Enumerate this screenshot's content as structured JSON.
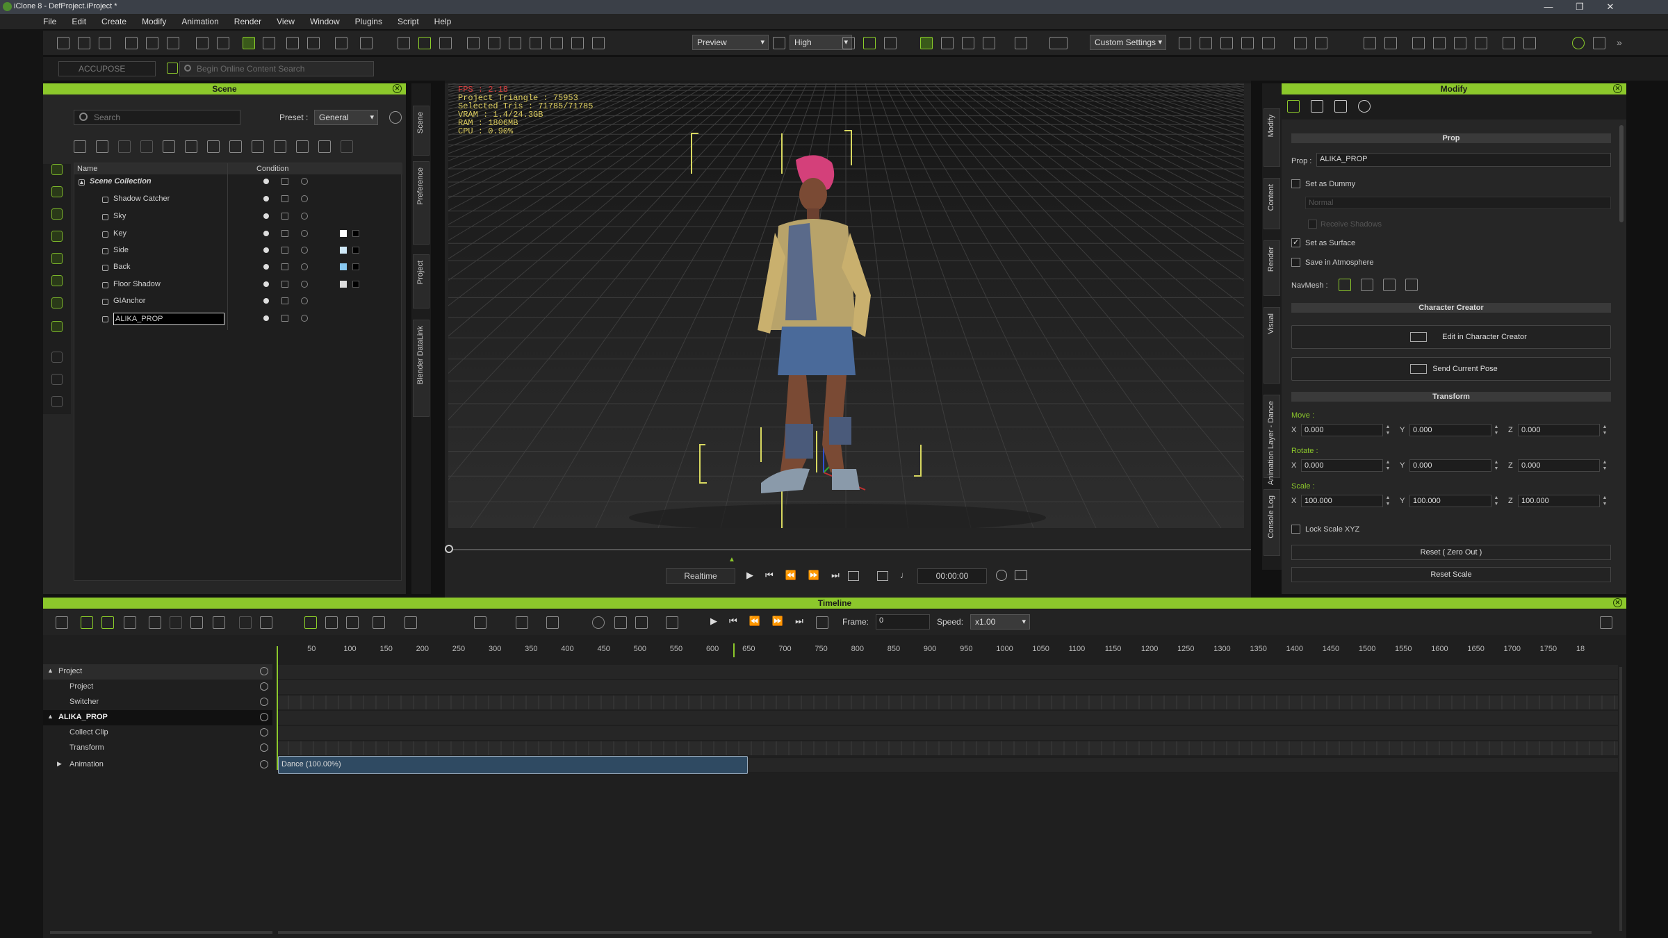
{
  "app": {
    "title": "iClone 8 - DefProject.iProject *"
  },
  "menu": [
    "File",
    "Edit",
    "Create",
    "Modify",
    "Animation",
    "Render",
    "View",
    "Window",
    "Plugins",
    "Script",
    "Help"
  ],
  "toolbar": {
    "preview_label": "Preview",
    "quality_label": "High",
    "settings_label": "Custom Settings",
    "accupose_label": "ACCUPOSE",
    "search_placeholder": "Begin Online Content Search"
  },
  "scene_panel": {
    "title": "Scene",
    "search_placeholder": "Search",
    "preset_label": "Preset :",
    "preset_value": "General",
    "columns": {
      "name": "Name",
      "condition": "Condition"
    },
    "items": [
      {
        "label": "Scene Collection"
      },
      {
        "label": "Shadow Catcher"
      },
      {
        "label": "Sky"
      },
      {
        "label": "Key"
      },
      {
        "label": "Side"
      },
      {
        "label": "Back"
      },
      {
        "label": "Floor Shadow"
      },
      {
        "label": "GIAnchor"
      },
      {
        "label": "ALIKA_PROP"
      }
    ]
  },
  "side_tabs_left": [
    "Scene",
    "Preference",
    "Project",
    "Blender DataLink"
  ],
  "side_tabs_right": [
    "Modify",
    "Content",
    "Render",
    "Visual",
    "Animation Layer - Dance",
    "Console Log"
  ],
  "viewport": {
    "stats": {
      "fps": "FPS : 2.18",
      "triangles": "Project Triangle : 75953",
      "selected": "Selected Tris : 71785/71785",
      "vram": "VRAM : 1.4/24.3GB",
      "ram": "RAM : 1806MB",
      "cpu": "CPU : 0.90%"
    },
    "playback_mode": "Realtime",
    "timecode": "00:00:00"
  },
  "modify_panel": {
    "title": "Modify",
    "prop_section": "Prop",
    "prop_label": "Prop :",
    "prop_value": "ALIKA_PROP",
    "set_as_dummy": "Set as Dummy",
    "normal_option": "Normal",
    "receive_shadows": "Receive Shadows",
    "set_as_surface": "Set as Surface",
    "save_in_atmosphere": "Save in Atmosphere",
    "navmesh_label": "NavMesh :",
    "cc_section": "Character Creator",
    "edit_in_cc": "Edit in Character Creator",
    "send_pose": "Send Current Pose",
    "transform_section": "Transform",
    "move_label": "Move :",
    "rotate_label": "Rotate :",
    "scale_label": "Scale :",
    "axis": {
      "x": "X",
      "y": "Y",
      "z": "Z"
    },
    "move": {
      "x": "0.000",
      "y": "0.000",
      "z": "0.000"
    },
    "rotate": {
      "x": "0.000",
      "y": "0.000",
      "z": "0.000"
    },
    "scale": {
      "x": "100.000",
      "y": "100.000",
      "z": "100.000"
    },
    "lock_scale": "Lock Scale XYZ",
    "reset_zero": "Reset ( Zero Out )",
    "reset_scale": "Reset Scale"
  },
  "timeline": {
    "title": "Timeline",
    "frame_label": "Frame:",
    "frame_value": "0",
    "speed_label": "Speed:",
    "speed_value": "x1.00",
    "ruler": [
      "50",
      "100",
      "150",
      "200",
      "250",
      "300",
      "350",
      "400",
      "450",
      "500",
      "550",
      "600",
      "650",
      "700",
      "750",
      "800",
      "850",
      "900",
      "950",
      "1000",
      "1050",
      "1100",
      "1150",
      "1200",
      "1250",
      "1300",
      "1350",
      "1400",
      "1450",
      "1500",
      "1550",
      "1600",
      "1650",
      "1700",
      "1750",
      "18"
    ],
    "tracks": [
      {
        "label": "Project"
      },
      {
        "label": "Project"
      },
      {
        "label": "Switcher"
      },
      {
        "label": "ALIKA_PROP"
      },
      {
        "label": "Collect Clip"
      },
      {
        "label": "Transform"
      },
      {
        "label": "Animation"
      }
    ],
    "clip_label": "Dance (100.00%)",
    "playhead_frame": 630
  },
  "colors": {
    "accent": "#8cc82b",
    "panel": "#262626",
    "clip": "#2f4a62"
  }
}
